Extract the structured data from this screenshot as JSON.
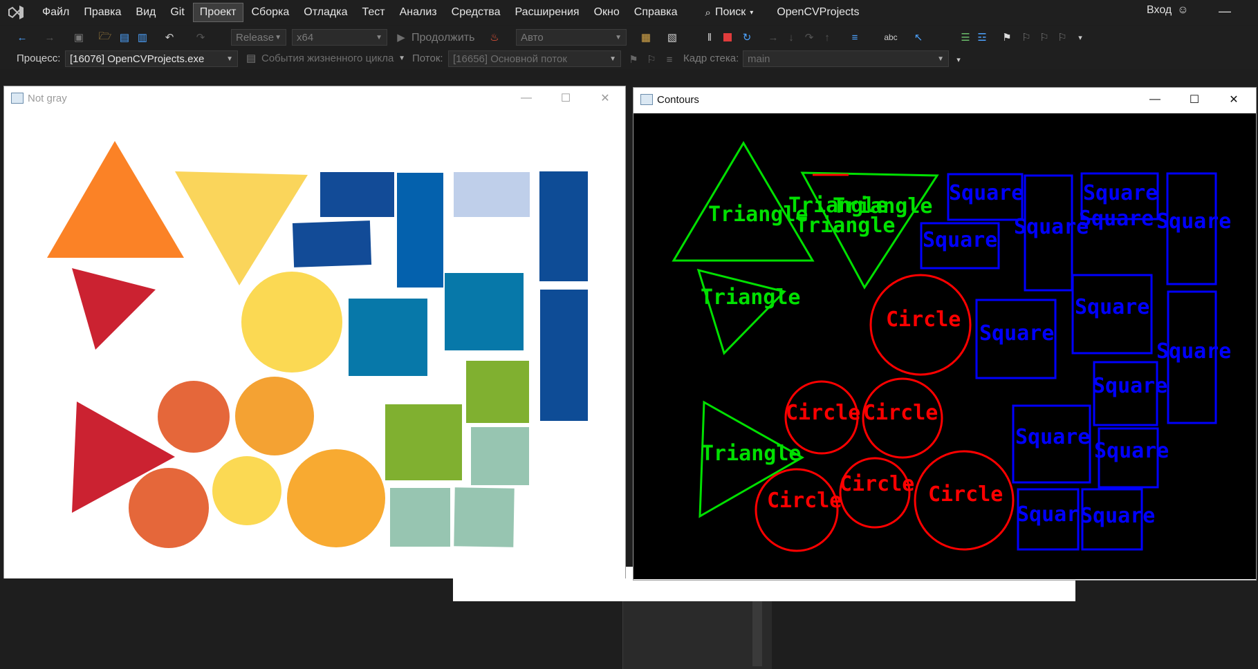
{
  "menubar": {
    "items": [
      "Файл",
      "Правка",
      "Вид",
      "Git",
      "Проект",
      "Сборка",
      "Отладка",
      "Тест",
      "Анализ",
      "Средства",
      "Расширения",
      "Окно",
      "Справка"
    ],
    "active_index": 4,
    "search_label": "Поиск",
    "project_name": "OpenCVProjects",
    "signin_label": "Вход"
  },
  "toolbar": {
    "configuration": "Release",
    "platform": "x64",
    "continue_label": "Продолжить",
    "auto_label": "Авто"
  },
  "debugbar": {
    "process_label": "Процесс:",
    "process_value": "[16076] OpenCVProjects.exe",
    "lifecycle_label": "События жизненного цикла",
    "thread_label": "Поток:",
    "thread_value": "[16656] Основной поток",
    "stackframe_label": "Кадр стека:",
    "stackframe_value": "main"
  },
  "windows": {
    "left_title": "Not gray",
    "right_title": "Contours"
  },
  "contours": {
    "labels": {
      "triangle": "Triangle",
      "circle": "Circle",
      "square": "Square",
      "square_partial": "Squar"
    }
  },
  "colors": {
    "ide_bg": "#1e1e1e",
    "triangle_contour": "#00e000",
    "circle_contour": "#ff0000",
    "square_contour": "#0000ff"
  }
}
